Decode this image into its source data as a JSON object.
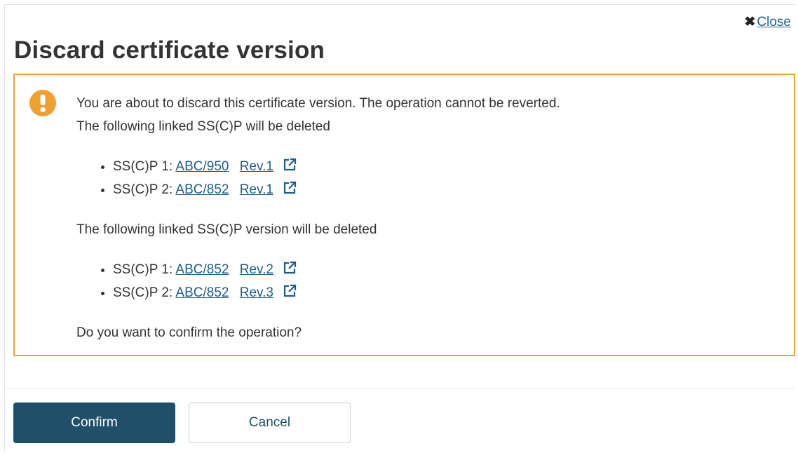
{
  "dialog": {
    "title": "Discard certificate version",
    "close": {
      "icon": "close-icon",
      "label": "Close"
    }
  },
  "alert": {
    "icon": "exclamation-icon",
    "border_color": "#f0a030",
    "icon_color": "#f0a030",
    "message_line1": "You are about to discard this certificate version. The operation cannot be reverted.",
    "message_line2": "The following linked SS(C)P will be deleted",
    "linked_items": [
      {
        "label": "SS(C)P 1:",
        "ref": "ABC/950",
        "rev": "Rev.1",
        "icon": "external-link-icon"
      },
      {
        "label": "SS(C)P 2:",
        "ref": "ABC/852",
        "rev": "Rev.1",
        "icon": "external-link-icon"
      }
    ],
    "message_line3": "The following linked SS(C)P version will be deleted",
    "linked_versions": [
      {
        "label": "SS(C)P 1:",
        "ref": "ABC/852",
        "rev": "Rev.2",
        "icon": "external-link-icon"
      },
      {
        "label": "SS(C)P 2:",
        "ref": "ABC/852",
        "rev": "Rev.3",
        "icon": "external-link-icon"
      }
    ],
    "question": "Do you want to confirm the operation?"
  },
  "footer": {
    "confirm_label": "Confirm",
    "cancel_label": "Cancel",
    "confirm_color": "#1f4f69",
    "link_color": "#1d5c8b"
  }
}
